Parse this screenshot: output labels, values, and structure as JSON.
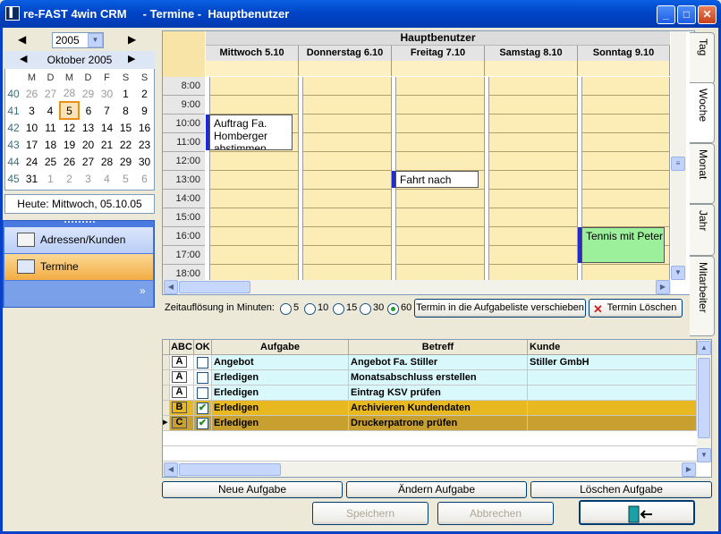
{
  "window": {
    "title": "re-FAST 4win CRM     - Termine -  Hauptbenutzer",
    "icon": "app-logo-icon"
  },
  "calendar": {
    "year": "2005",
    "month_label": "Oktober 2005",
    "weekday_headers": [
      "M",
      "D",
      "M",
      "D",
      "F",
      "S",
      "S"
    ],
    "weeks": [
      {
        "wk": "40",
        "days": [
          "26",
          "27",
          "28",
          "29",
          "30",
          "1",
          "2"
        ]
      },
      {
        "wk": "41",
        "days": [
          "3",
          "4",
          "5",
          "6",
          "7",
          "8",
          "9"
        ]
      },
      {
        "wk": "42",
        "days": [
          "10",
          "11",
          "12",
          "13",
          "14",
          "15",
          "16"
        ]
      },
      {
        "wk": "43",
        "days": [
          "17",
          "18",
          "19",
          "20",
          "21",
          "22",
          "23"
        ]
      },
      {
        "wk": "44",
        "days": [
          "24",
          "25",
          "26",
          "27",
          "28",
          "29",
          "30"
        ]
      },
      {
        "wk": "45",
        "days": [
          "31",
          "1",
          "2",
          "3",
          "4",
          "5",
          "6"
        ]
      }
    ],
    "today_label": "Heute: Mittwoch, 05.10.05"
  },
  "nav": {
    "items": [
      {
        "label": "Adressen/Kunden",
        "icon": "address-card-icon"
      },
      {
        "label": "Termine",
        "icon": "calendar-icon"
      }
    ]
  },
  "scheduler": {
    "owner": "Hauptbenutzer",
    "days": [
      "Mittwoch 5.10",
      "Donnerstag 6.10",
      "Freitag 7.10",
      "Samstag 8.10",
      "Sonntag 9.10"
    ],
    "times": [
      "8:00",
      "9:00",
      "10:00",
      "11:00",
      "12:00",
      "13:00",
      "14:00",
      "15:00",
      "16:00",
      "17:00",
      "18:00"
    ],
    "appointments": [
      {
        "text": "Auftrag Fa. Homberger abstimmen",
        "day": "Mittwoch 5.10",
        "start": "10:00",
        "end": "12:00"
      },
      {
        "text": "Fahrt nach",
        "day": "Freitag 7.10",
        "start": "13:00",
        "end": "14:00"
      },
      {
        "text": "Tennis mit Peter",
        "day": "Sonntag 9.10",
        "start": "16:00",
        "end": "18:00",
        "color": "#9cf09c"
      }
    ],
    "tabs": [
      "Tag",
      "Woche",
      "Monat",
      "Jahr",
      "Mitarbeiter"
    ],
    "active_tab": "Woche"
  },
  "resolution": {
    "label": "Zeitauflösung in Minuten:",
    "options": [
      "5",
      "10",
      "15",
      "30",
      "60"
    ],
    "selected": "60",
    "move_button": "Termin in die Aufgabeliste verschieben",
    "delete_button": "Termin  Löschen"
  },
  "tasks": {
    "columns": [
      "ABC",
      "OK",
      "Aufgabe",
      "Betreff",
      "Kunde"
    ],
    "rows": [
      {
        "abc": "A",
        "ok": false,
        "aufgabe": "Angebot",
        "betreff": "Angebot Fa. Stiller",
        "kunde": "Stiller GmbH",
        "color": "#d8f8fc"
      },
      {
        "abc": "A",
        "ok": false,
        "aufgabe": "Erledigen",
        "betreff": "Monatsabschluss erstellen",
        "kunde": "",
        "color": "#d8f8fc"
      },
      {
        "abc": "A",
        "ok": false,
        "aufgabe": "Erledigen",
        "betreff": "Eintrag KSV prüfen",
        "kunde": "",
        "color": "#d8f8fc"
      },
      {
        "abc": "B",
        "ok": true,
        "aufgabe": "Erledigen",
        "betreff": "Archivieren Kundendaten",
        "kunde": "",
        "color": "#e8b820"
      },
      {
        "abc": "C",
        "ok": true,
        "aufgabe": "Erledigen",
        "betreff": "Druckerpatrone prüfen",
        "kunde": "",
        "color": "#c8a030"
      }
    ]
  },
  "buttons": {
    "new_task": "Neue Aufgabe",
    "change_task": "Ändern Aufgabe",
    "delete_task": "Löschen Aufgabe",
    "save": "Speichern",
    "cancel": "Abbrechen",
    "exit_icon": "exit-door-icon"
  }
}
